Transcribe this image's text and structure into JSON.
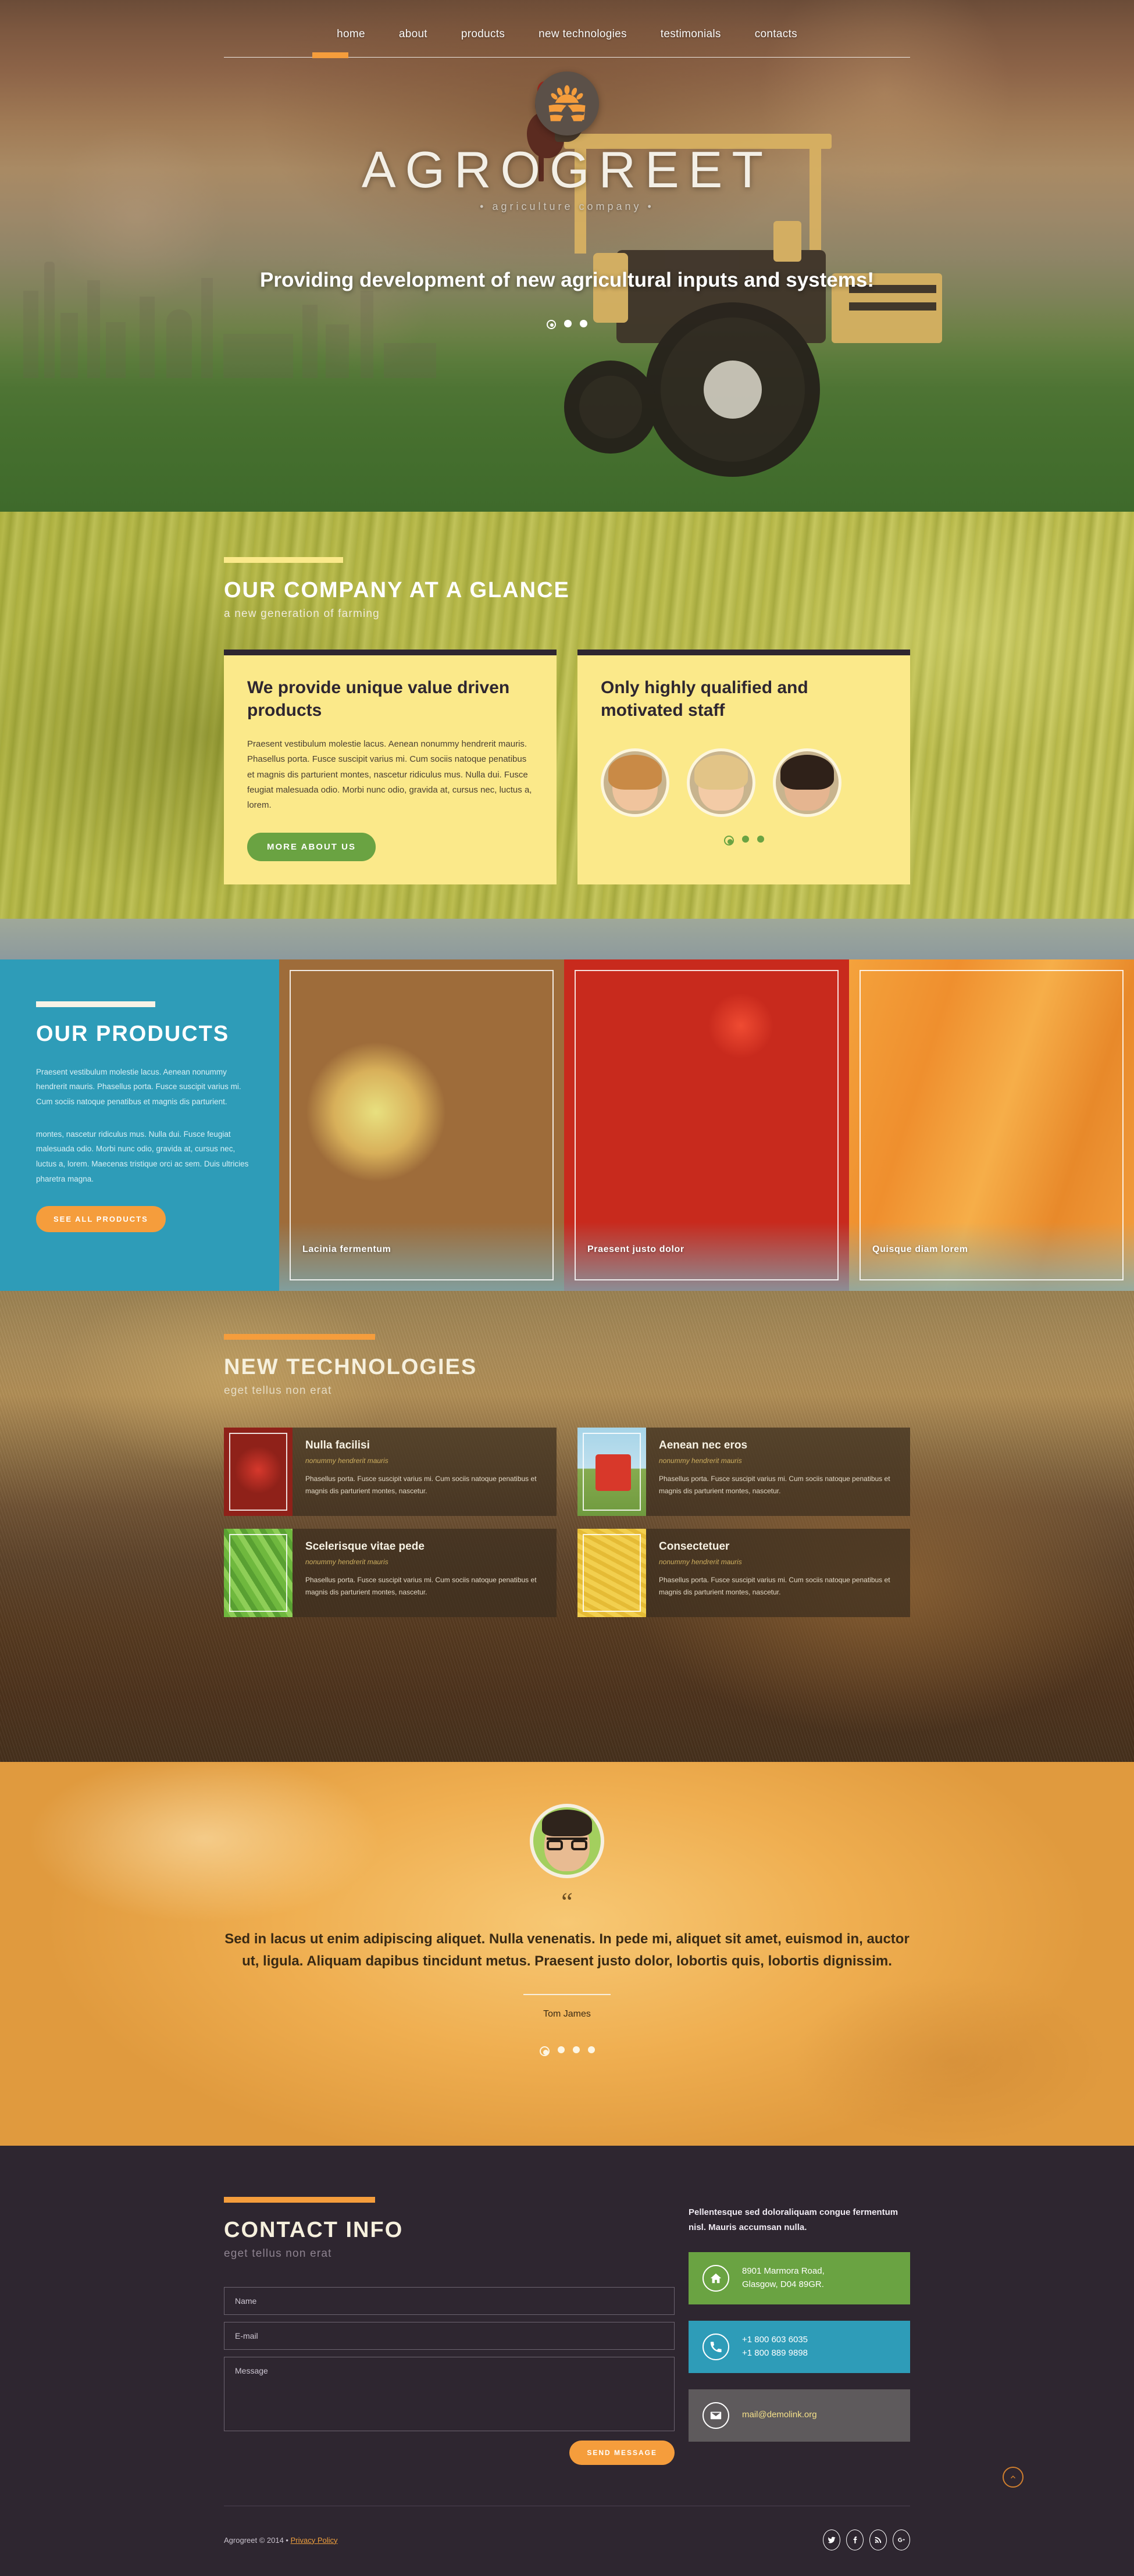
{
  "nav": {
    "items": [
      {
        "label": "home",
        "active": true
      },
      {
        "label": "about",
        "active": false
      },
      {
        "label": "products",
        "active": false
      },
      {
        "label": "new technologies",
        "active": false
      },
      {
        "label": "testimonials",
        "active": false
      },
      {
        "label": "contacts",
        "active": false
      }
    ]
  },
  "hero": {
    "logo_icon": "sun-over-fields-icon",
    "brand": "AGROGREET",
    "brand_sub": "• agriculture company •",
    "tagline": "Providing development of new agricultural inputs and systems!",
    "slider_dots": 3,
    "active_dot": 0
  },
  "glance": {
    "title": "OUR COMPANY AT A GLANCE",
    "subtitle": "a new generation of farming",
    "card1": {
      "heading": "We provide unique value driven products",
      "body": "Praesent vestibulum molestie lacus. Aenean nonummy hendrerit mauris. Phasellus porta. Fusce suscipit varius mi. Cum sociis natoque penatibus et magnis dis parturient montes, nascetur ridiculus mus. Nulla dui. Fusce feugiat malesuada odio. Morbi nunc odio, gravida at, cursus nec, luctus a, lorem.",
      "button": "MORE ABOUT US"
    },
    "card2": {
      "heading": "Only highly qualified and motivated staff",
      "avatars": [
        "staff-avatar-woman-1",
        "staff-avatar-woman-2",
        "staff-avatar-man-1"
      ],
      "dots": 3,
      "active_dot": 0
    }
  },
  "products": {
    "title": "OUR PRODUCTS",
    "body1": "Praesent vestibulum molestie lacus. Aenean nonummy hendrerit mauris. Phasellus porta. Fusce suscipit varius mi. Cum sociis natoque penatibus et magnis dis parturient.",
    "body2": "montes, nascetur ridiculus mus. Nulla dui. Fusce feugiat malesuada odio. Morbi nunc odio, gravida at, cursus nec, luctus a, lorem. Maecenas tristique orci ac sem. Duis ultricies pharetra magna.",
    "button": "SEE ALL PRODUCTS",
    "tiles": [
      {
        "caption": "Lacinia fermentum",
        "image": "apples-photo"
      },
      {
        "caption": "Praesent justo dolor",
        "image": "tomatoes-crate-photo"
      },
      {
        "caption": "Quisque diam lorem",
        "image": "carrots-photo"
      }
    ]
  },
  "technologies": {
    "title": "NEW TECHNOLOGIES",
    "subtitle": "eget tellus non erat",
    "cards": [
      {
        "title": "Nulla facilisi",
        "sub": "nonummy hendrerit mauris",
        "body": "Phasellus porta. Fusce suscipit varius mi. Cum sociis natoque penatibus et magnis dis parturient montes, nascetur.",
        "image": "apple-in-hands-photo"
      },
      {
        "title": "Aenean nec eros",
        "sub": "nonummy hendrerit mauris",
        "body": "Phasellus porta. Fusce suscipit varius mi. Cum sociis natoque penatibus et magnis dis parturient montes, nascetur.",
        "image": "red-tractor-photo"
      },
      {
        "title": "Scelerisque vitae pede",
        "sub": "nonummy hendrerit mauris",
        "body": "Phasellus porta. Fusce suscipit varius mi. Cum sociis natoque penatibus et magnis dis parturient montes, nascetur.",
        "image": "green-beans-photo"
      },
      {
        "title": "Consectetuer",
        "sub": "nonummy hendrerit mauris",
        "body": "Phasellus porta. Fusce suscipit varius mi. Cum sociis natoque penatibus et magnis dis parturient montes, nascetur.",
        "image": "corn-cob-photo"
      }
    ]
  },
  "testimonial": {
    "avatar": "testimonial-avatar-man-glasses",
    "quote_mark": "“",
    "quote": "Sed in lacus ut enim adipiscing aliquet. Nulla venenatis. In pede mi, aliquet sit amet, euismod in, auctor ut, ligula. Aliquam dapibus tincidunt metus. Praesent justo dolor, lobortis quis, lobortis dignissim.",
    "author": "Tom James",
    "dots": 4,
    "active_dot": 0
  },
  "contact": {
    "title": "CONTACT INFO",
    "subtitle": "eget tellus non erat",
    "form": {
      "name_placeholder": "Name",
      "name_value": "",
      "email_placeholder": "E-mail",
      "email_value": "",
      "message_placeholder": "Message",
      "message_value": "",
      "submit_label": "SEND MESSAGE"
    },
    "blurb": "Pellentesque sed doloraliquam congue fermentum nisl. Mauris accumsan nulla.",
    "address": "8901 Marmora Road,\nGlasgow, D04 89GR.",
    "phones": "+1 800 603 6035\n+1 800 889 9898",
    "email": "mail@demolink.org",
    "address_icon": "home-icon",
    "phone_icon": "phone-icon",
    "email_icon": "envelope-icon",
    "colors": {
      "address_bg": "#6aa342",
      "phone_bg": "#2e9cb8",
      "email_bg": "#5e5a5c"
    }
  },
  "footer": {
    "copyright": "Agrogreet © 2014 • ",
    "privacy_label": "Privacy Policy",
    "socials": [
      "twitter-icon",
      "facebook-icon",
      "rss-icon",
      "google-plus-icon"
    ],
    "to_top_icon": "chevron-up-icon"
  },
  "colors": {
    "accent_orange": "#f59d3c",
    "green": "#6aa342",
    "blue": "#2e9cb8",
    "yellow_card": "#fbe98a",
    "dark": "#2e2630"
  }
}
